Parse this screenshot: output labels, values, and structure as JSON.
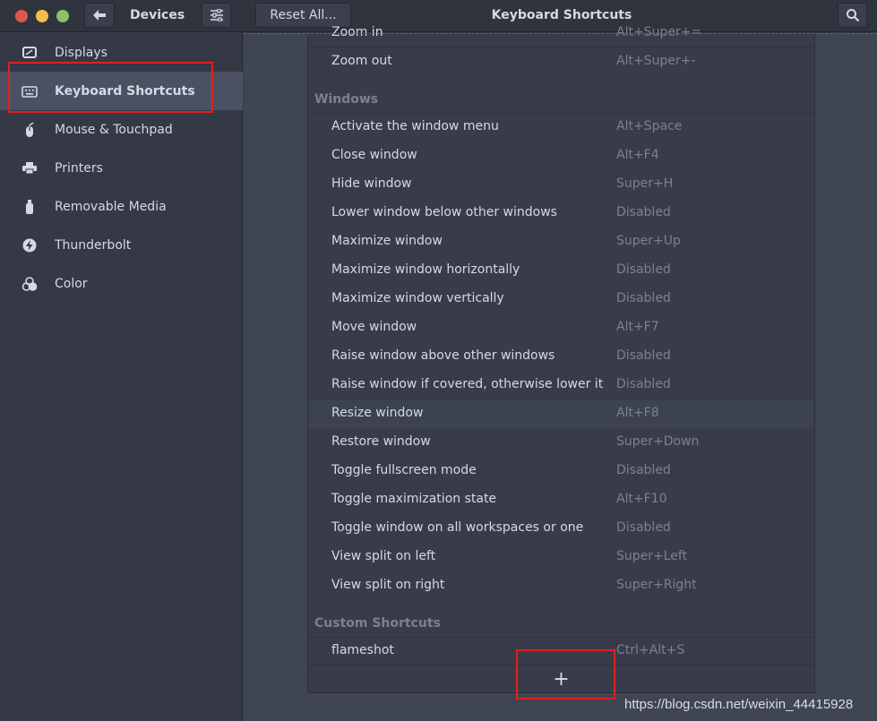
{
  "header": {
    "back_icon": "arrow-left-icon",
    "panel_title": "Devices",
    "menu_icon": "sliders-icon",
    "reset_label": "Reset All...",
    "window_title": "Keyboard Shortcuts",
    "search_icon": "search-icon"
  },
  "sidebar": {
    "items": [
      {
        "label": "Displays",
        "icon": "display-icon"
      },
      {
        "label": "Keyboard Shortcuts",
        "icon": "keyboard-icon",
        "selected": true
      },
      {
        "label": "Mouse & Touchpad",
        "icon": "mouse-icon"
      },
      {
        "label": "Printers",
        "icon": "printer-icon"
      },
      {
        "label": "Removable Media",
        "icon": "usb-drive-icon"
      },
      {
        "label": "Thunderbolt",
        "icon": "thunderbolt-icon"
      },
      {
        "label": "Color",
        "icon": "color-icon"
      }
    ]
  },
  "shortcuts": {
    "partial_top": {
      "name": "Zoom in",
      "accel": "Alt+Super+="
    },
    "zoom_out": {
      "name": "Zoom out",
      "accel": "Alt+Super+-"
    },
    "windows_title": "Windows",
    "windows": [
      {
        "name": "Activate the window menu",
        "accel": "Alt+Space"
      },
      {
        "name": "Close window",
        "accel": "Alt+F4"
      },
      {
        "name": "Hide window",
        "accel": "Super+H"
      },
      {
        "name": "Lower window below other windows",
        "accel": "Disabled"
      },
      {
        "name": "Maximize window",
        "accel": "Super+Up"
      },
      {
        "name": "Maximize window horizontally",
        "accel": "Disabled"
      },
      {
        "name": "Maximize window vertically",
        "accel": "Disabled"
      },
      {
        "name": "Move window",
        "accel": "Alt+F7"
      },
      {
        "name": "Raise window above other windows",
        "accel": "Disabled"
      },
      {
        "name": "Raise window if covered, otherwise lower it",
        "accel": "Disabled"
      },
      {
        "name": "Resize window",
        "accel": "Alt+F8"
      },
      {
        "name": "Restore window",
        "accel": "Super+Down"
      },
      {
        "name": "Toggle fullscreen mode",
        "accel": "Disabled"
      },
      {
        "name": "Toggle maximization state",
        "accel": "Alt+F10"
      },
      {
        "name": "Toggle window on all workspaces or one",
        "accel": "Disabled"
      },
      {
        "name": "View split on left",
        "accel": "Super+Left"
      },
      {
        "name": "View split on right",
        "accel": "Super+Right"
      }
    ],
    "custom_title": "Custom Shortcuts",
    "custom": [
      {
        "name": "flameshot",
        "accel": "Ctrl+Alt+S"
      }
    ],
    "add_label": "+"
  },
  "watermark": "https://blog.csdn.net/weixin_44415928",
  "colors": {
    "accent_highlight": "#e02020",
    "selected_bg": "#4b5162",
    "headerbar_bg": "#2f343f"
  }
}
